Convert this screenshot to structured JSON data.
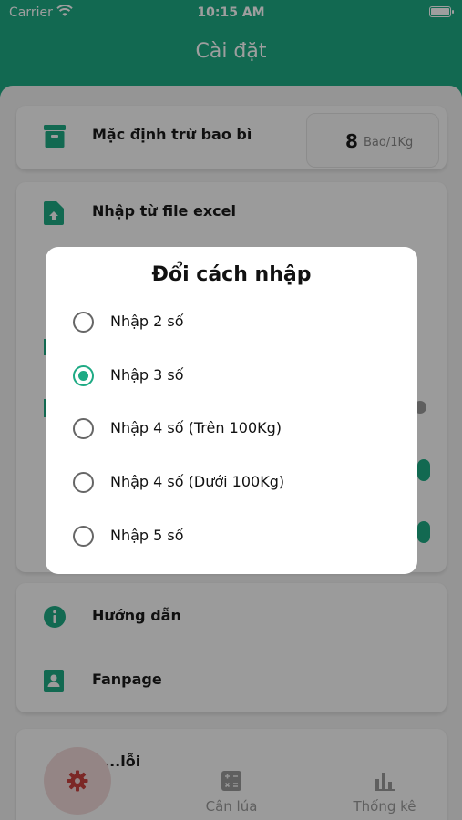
{
  "status_bar": {
    "carrier": "Carrier",
    "time": "10:15 AM"
  },
  "header": {
    "title": "Cài đặt"
  },
  "settings": {
    "packaging_label": "Mặc định trừ bao bì",
    "packaging_value": "8",
    "packaging_unit": "Bao/1Kg",
    "import_excel_label": "Nhập từ file excel",
    "guide_label": "Hướng dẫn",
    "fanpage_label": "Fanpage",
    "report_label_partial": "...lỗi"
  },
  "modal": {
    "title": "Đổi cách nhập",
    "options": [
      {
        "label": "Nhập 2 số",
        "selected": false
      },
      {
        "label": "Nhập 3 số",
        "selected": true
      },
      {
        "label": "Nhập 4 số (Trên 100Kg)",
        "selected": false
      },
      {
        "label": "Nhập 4 số (Dưới 100Kg)",
        "selected": false
      },
      {
        "label": "Nhập 5 số",
        "selected": false
      }
    ]
  },
  "tabs": {
    "weigh": "Cân lúa",
    "stats": "Thống kê"
  },
  "colors": {
    "accent": "#1eaa84",
    "settings_tab_bg": "#efd7d7",
    "settings_tab_icon": "#c8413e"
  },
  "icons": {
    "packaging": "archive-box-icon",
    "import": "file-upload-icon",
    "guide": "info-icon",
    "fanpage": "contact-card-icon",
    "settings_tab": "gear-icon",
    "weigh_tab": "calculator-icon",
    "stats_tab": "bar-chart-icon"
  }
}
